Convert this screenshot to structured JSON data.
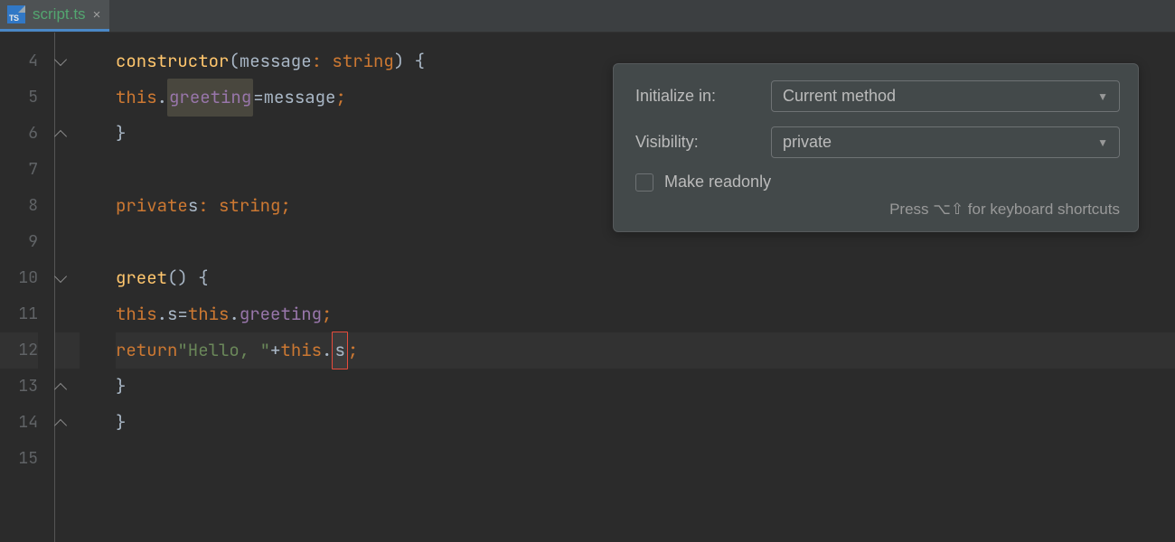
{
  "tab": {
    "icon_text": "TS",
    "filename": "script.ts"
  },
  "gutter": {
    "start": 4,
    "end": 15,
    "caret_line": 12
  },
  "code": {
    "l4": {
      "kw_constructor": "constructor",
      "param": "message",
      "type": "string"
    },
    "l5": {
      "this": "this",
      "prop": "greeting",
      "rhs": "message"
    },
    "l8": {
      "kw_private": "private",
      "name": "s",
      "type": "string"
    },
    "l10": {
      "fn": "greet"
    },
    "l11": {
      "this1": "this",
      "lhs": "s",
      "this2": "this",
      "rhs": "greeting"
    },
    "l12": {
      "kw_return": "return",
      "str": "\"Hello, \"",
      "this": "this",
      "var": "s"
    }
  },
  "popup": {
    "initialize_label": "Initialize in:",
    "initialize_value": "Current method",
    "visibility_label": "Visibility:",
    "visibility_value": "private",
    "readonly_label": "Make readonly",
    "readonly_checked": false,
    "hint": "Press ⌥⇧ for keyboard shortcuts"
  }
}
